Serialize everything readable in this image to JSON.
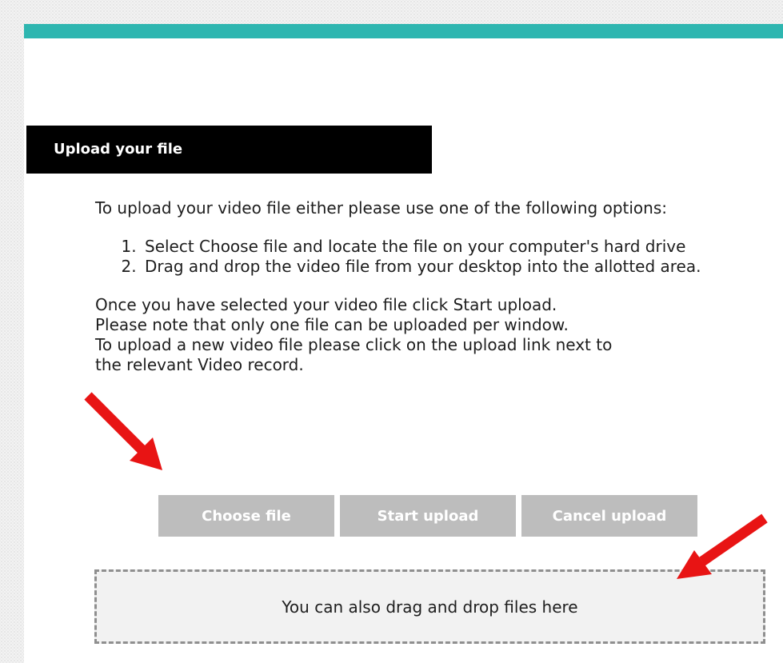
{
  "header": {
    "title": "Upload your file"
  },
  "instructions": {
    "intro": "To upload your video file either please use one of the following options:",
    "options": [
      "Select Choose file and locate the file on your computer's hard drive",
      "Drag and drop the video file from your desktop into the allotted area."
    ],
    "note_lines": [
      "Once you have selected your video file click Start upload.",
      "Please note that only one file can be uploaded per window.",
      "To upload a new video file please click on the upload link next to",
      "the relevant Video record."
    ]
  },
  "buttons": {
    "choose": "Choose file",
    "start": "Start upload",
    "cancel": "Cancel upload"
  },
  "dropzone": {
    "label": "You can also drag and drop files here"
  },
  "colors": {
    "accent": "#2eb6b0",
    "header_bg": "#000000",
    "button_bg": "#bdbdbd",
    "annotation_arrow": "#e81414"
  }
}
